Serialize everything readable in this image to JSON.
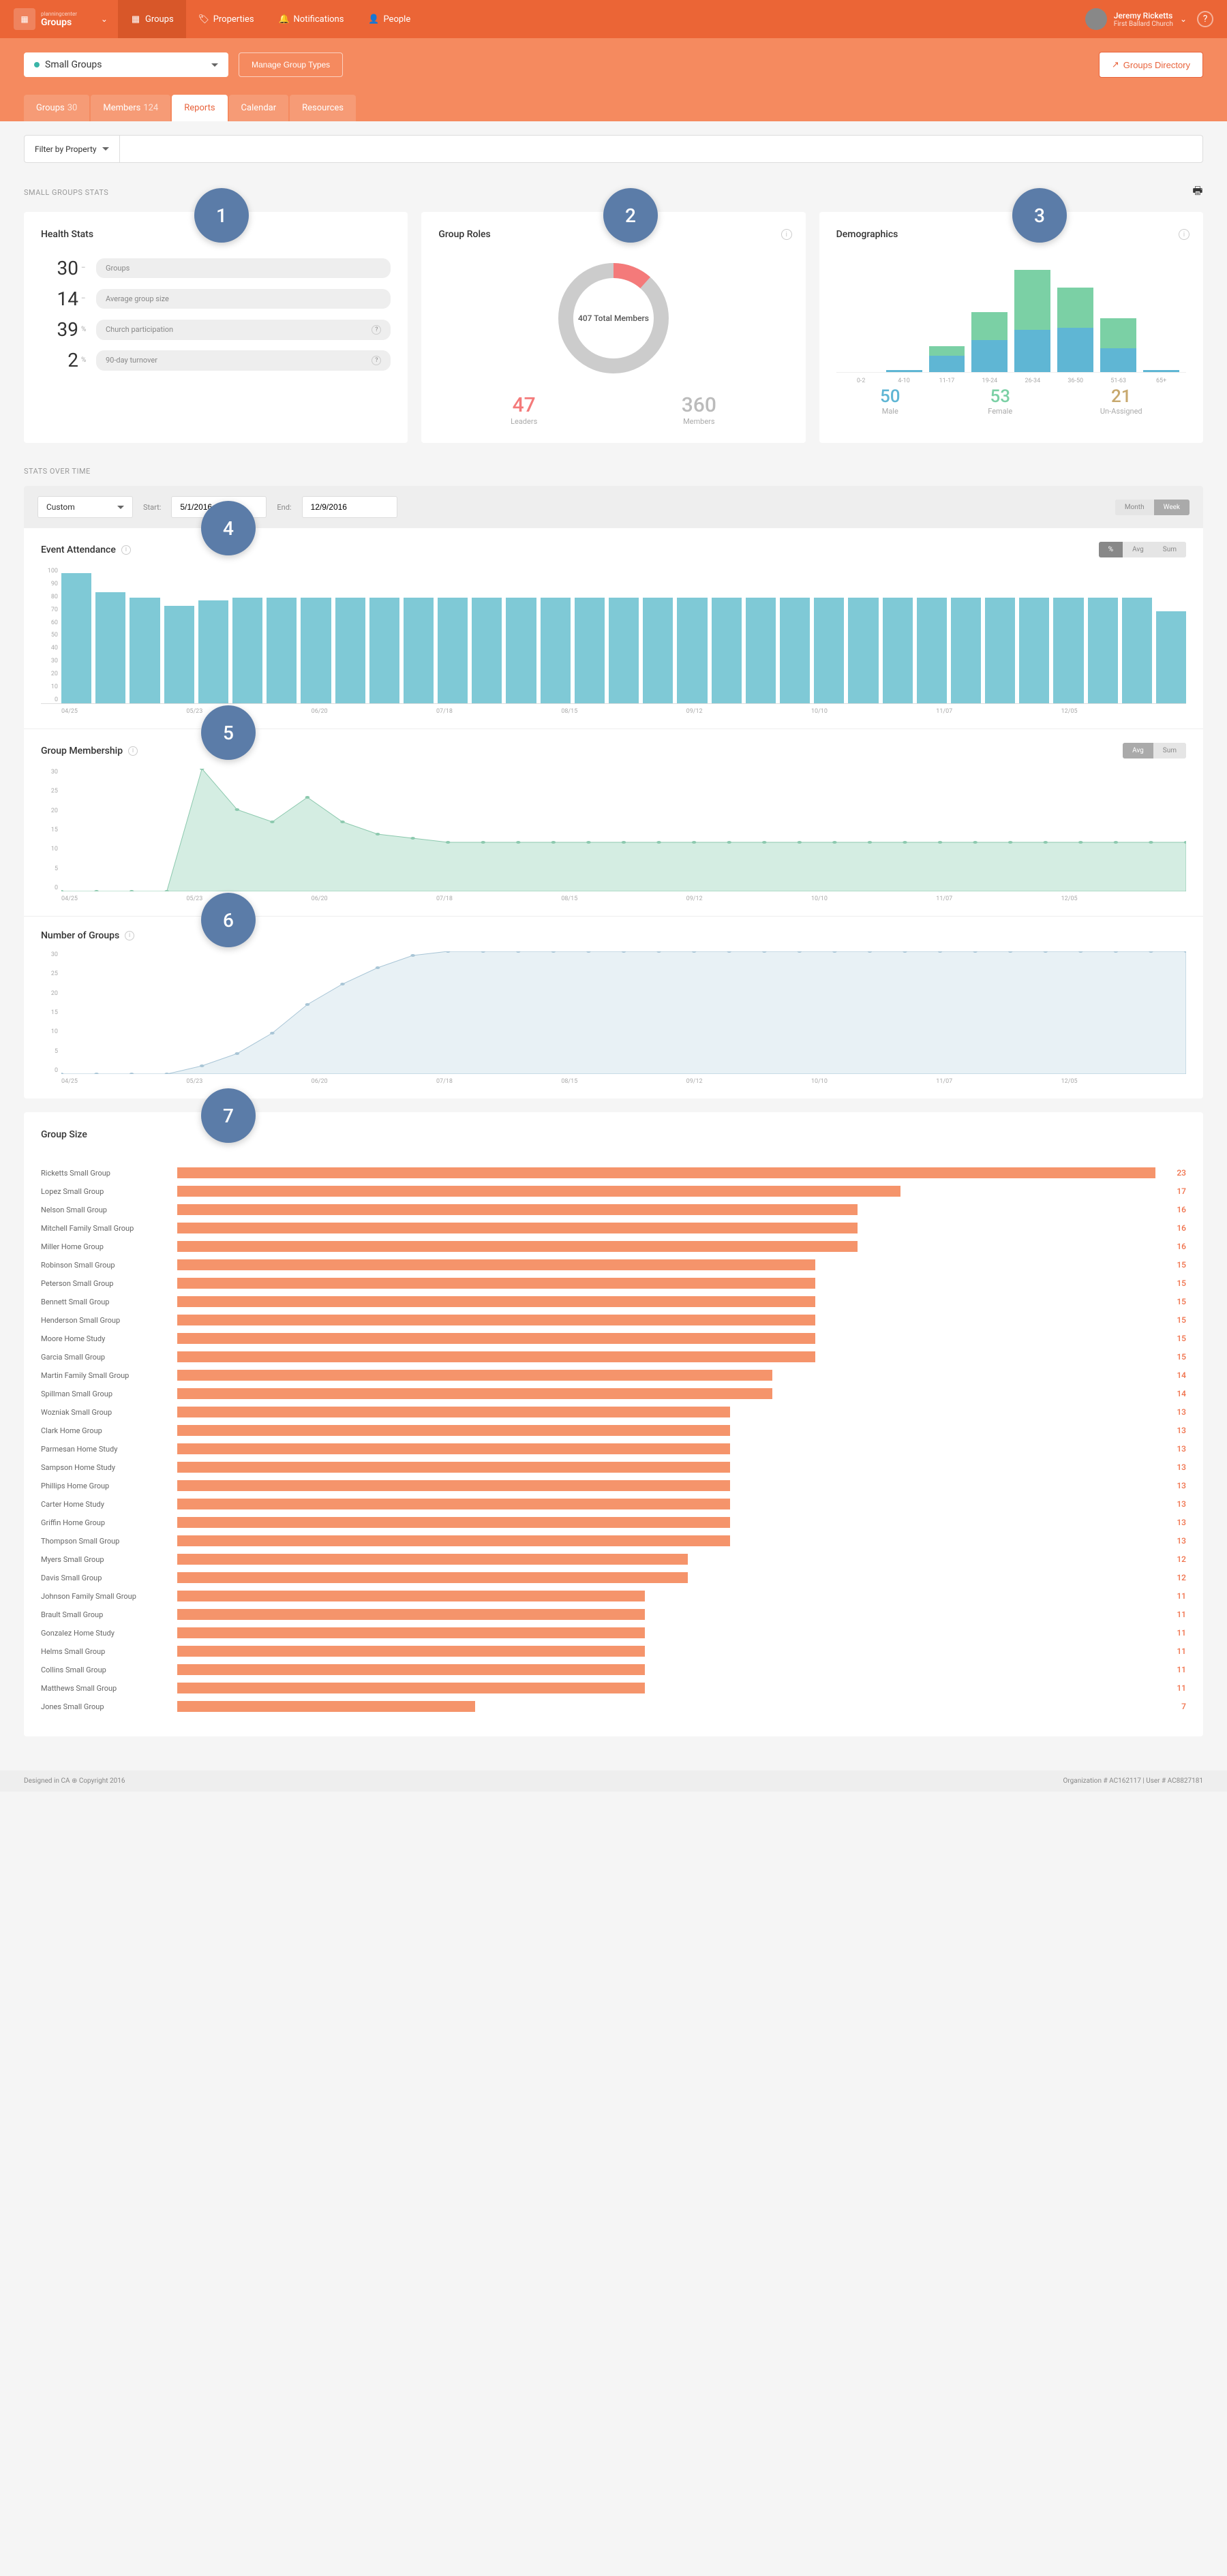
{
  "app": {
    "name": "Groups",
    "brand": "planningcenter"
  },
  "nav": [
    {
      "label": "Groups",
      "icon": "grid"
    },
    {
      "label": "Properties",
      "icon": "tag"
    },
    {
      "label": "Notifications",
      "icon": "bell"
    },
    {
      "label": "People",
      "icon": "person"
    }
  ],
  "user": {
    "name": "Jeremy Ricketts",
    "sub": "First Ballard Church"
  },
  "group_type": "Small Groups",
  "manage_btn": "Manage Group Types",
  "directory_btn": "Groups Directory",
  "tabs": [
    {
      "label": "Groups",
      "count": "30"
    },
    {
      "label": "Members",
      "count": "124"
    },
    {
      "label": "Reports"
    },
    {
      "label": "Calendar"
    },
    {
      "label": "Resources"
    }
  ],
  "filter_btn": "Filter by Property",
  "sec_stats": "SMALL GROUPS STATS",
  "health": {
    "title": "Health Stats",
    "rows": [
      {
        "num": "30",
        "unit": "–",
        "label": "Groups"
      },
      {
        "num": "14",
        "unit": "–",
        "label": "Average group size"
      },
      {
        "num": "39",
        "unit": "%",
        "label": "Church participation",
        "q": true
      },
      {
        "num": "2",
        "unit": "%",
        "label": "90-day turnover",
        "q": true
      }
    ]
  },
  "roles": {
    "title": "Group Roles",
    "center": "407 Total Members",
    "leaders": {
      "num": "47",
      "label": "Leaders"
    },
    "members": {
      "num": "360",
      "label": "Members"
    }
  },
  "demo": {
    "title": "Demographics",
    "male": {
      "num": "50",
      "label": "Male"
    },
    "female": {
      "num": "53",
      "label": "Female"
    },
    "unassigned": {
      "num": "21",
      "label": "Un-Assigned"
    }
  },
  "chart_data": {
    "demographics": {
      "type": "bar",
      "stacked": true,
      "categories": [
        "0-2",
        "4-10",
        "11-17",
        "19-24",
        "26-34",
        "36-50",
        "51-63",
        "65+"
      ],
      "series": [
        {
          "name": "Male",
          "values": [
            0,
            1,
            8,
            16,
            21,
            22,
            12,
            1
          ]
        },
        {
          "name": "Female",
          "values": [
            0,
            0,
            5,
            14,
            30,
            20,
            15,
            0
          ]
        }
      ]
    },
    "attendance": {
      "type": "bar",
      "title": "Event Attendance",
      "ylabel": "",
      "ylim": [
        0,
        100
      ],
      "yticks": [
        0,
        10,
        20,
        30,
        40,
        50,
        60,
        70,
        80,
        90,
        100
      ],
      "xticks": [
        "04/25",
        "05/23",
        "06/20",
        "07/18",
        "08/15",
        "09/12",
        "10/10",
        "11/07",
        "12/05"
      ],
      "values": [
        96,
        82,
        78,
        72,
        76,
        78,
        78,
        78,
        78,
        78,
        78,
        78,
        78,
        78,
        78,
        78,
        78,
        78,
        78,
        78,
        78,
        78,
        78,
        78,
        78,
        78,
        78,
        78,
        78,
        78,
        78,
        78,
        68
      ]
    },
    "membership": {
      "type": "area",
      "title": "Group Membership",
      "ylim": [
        0,
        30
      ],
      "yticks": [
        0,
        5,
        10,
        15,
        20,
        25,
        30
      ],
      "xticks": [
        "04/25",
        "05/23",
        "06/20",
        "07/18",
        "08/15",
        "09/12",
        "10/10",
        "11/07",
        "12/05"
      ],
      "values": [
        0,
        0,
        0,
        0,
        30,
        20,
        17,
        23,
        17,
        14,
        13,
        12,
        12,
        12,
        12,
        12,
        12,
        12,
        12,
        12,
        12,
        12,
        12,
        12,
        12,
        12,
        12,
        12,
        12,
        12,
        12,
        12,
        12
      ]
    },
    "num_groups": {
      "type": "area",
      "title": "Number of Groups",
      "ylim": [
        0,
        30
      ],
      "yticks": [
        0,
        5,
        10,
        15,
        20,
        25,
        30
      ],
      "xticks": [
        "04/25",
        "05/23",
        "06/20",
        "07/18",
        "08/15",
        "09/12",
        "10/10",
        "11/07",
        "12/05"
      ],
      "values": [
        0,
        0,
        0,
        0,
        2,
        5,
        10,
        17,
        22,
        26,
        29,
        30,
        30,
        30,
        30,
        30,
        30,
        30,
        30,
        30,
        30,
        30,
        30,
        30,
        30,
        30,
        30,
        30,
        30,
        30,
        30,
        30,
        30
      ]
    },
    "group_size": {
      "type": "bar",
      "orientation": "horizontal",
      "title": "Group Size",
      "items": [
        {
          "name": "Ricketts Small Group",
          "val": 23
        },
        {
          "name": "Lopez Small Group",
          "val": 17
        },
        {
          "name": "Nelson Small Group",
          "val": 16
        },
        {
          "name": "Mitchell Family Small Group",
          "val": 16
        },
        {
          "name": "Miller Home Group",
          "val": 16
        },
        {
          "name": "Robinson Small Group",
          "val": 15
        },
        {
          "name": "Peterson Small Group",
          "val": 15
        },
        {
          "name": "Bennett Small Group",
          "val": 15
        },
        {
          "name": "Henderson Small Group",
          "val": 15
        },
        {
          "name": "Moore Home Study",
          "val": 15
        },
        {
          "name": "Garcia Small Group",
          "val": 15
        },
        {
          "name": "Martin Family Small Group",
          "val": 14
        },
        {
          "name": "Spillman Small Group",
          "val": 14
        },
        {
          "name": "Wozniak Small Group",
          "val": 13
        },
        {
          "name": "Clark Home Group",
          "val": 13
        },
        {
          "name": "Parmesan Home Study",
          "val": 13
        },
        {
          "name": "Sampson Home Study",
          "val": 13
        },
        {
          "name": "Phillips Home Group",
          "val": 13
        },
        {
          "name": "Carter Home Study",
          "val": 13
        },
        {
          "name": "Griffin Home Group",
          "val": 13
        },
        {
          "name": "Thompson Small Group",
          "val": 13
        },
        {
          "name": "Myers Small Group",
          "val": 12
        },
        {
          "name": "Davis Small Group",
          "val": 12
        },
        {
          "name": "Johnson Family Small Group",
          "val": 11
        },
        {
          "name": "Brault Small Group",
          "val": 11
        },
        {
          "name": "Gonzalez Home Study",
          "val": 11
        },
        {
          "name": "Helms Small Group",
          "val": 11
        },
        {
          "name": "Collins Small Group",
          "val": 11
        },
        {
          "name": "Matthews Small Group",
          "val": 11
        },
        {
          "name": "Jones Small Group",
          "val": 7
        }
      ]
    }
  },
  "sec_time": "STATS OVER TIME",
  "time": {
    "range": "Custom",
    "start_lbl": "Start:",
    "start": "5/1/2016",
    "end_lbl": "End:",
    "end": "12/9/2016",
    "month": "Month",
    "week": "Week",
    "pct": "%",
    "avg": "Avg",
    "sum": "Sum"
  },
  "badges": [
    "1",
    "2",
    "3",
    "4",
    "5",
    "6",
    "7"
  ],
  "footer": {
    "left": "Designed in CA ⊕ Copyright 2016",
    "right": "Organization # AC162117  |  User # AC8827181"
  }
}
